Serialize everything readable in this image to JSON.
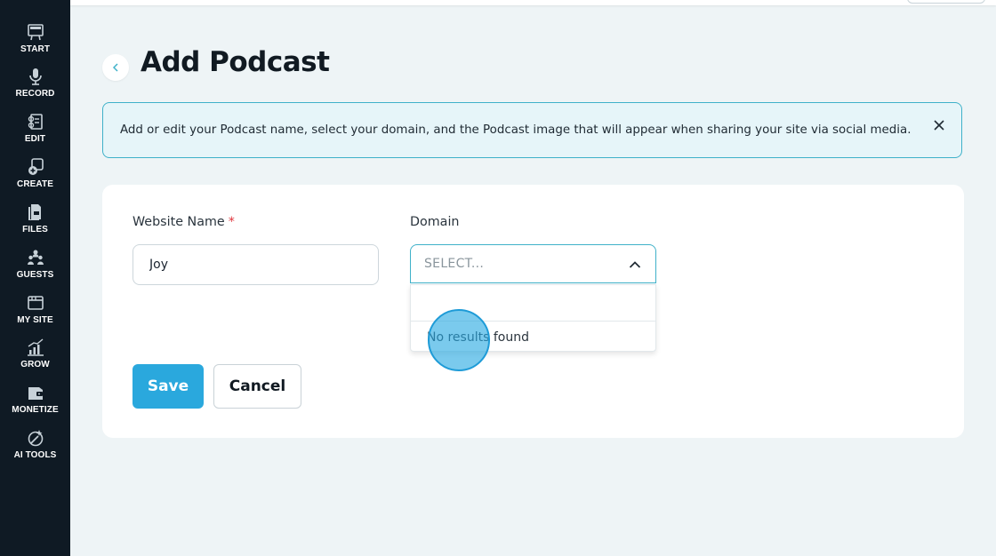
{
  "sidebar": {
    "items": [
      {
        "label": "START",
        "icon": "start-icon"
      },
      {
        "label": "RECORD",
        "icon": "microphone-icon"
      },
      {
        "label": "EDIT",
        "icon": "edit-icon"
      },
      {
        "label": "CREATE",
        "icon": "create-icon"
      },
      {
        "label": "FILES",
        "icon": "files-icon"
      },
      {
        "label": "GUESTS",
        "icon": "guests-icon"
      },
      {
        "label": "MY SITE",
        "icon": "my-site-icon"
      },
      {
        "label": "GROW",
        "icon": "grow-chart-icon"
      },
      {
        "label": "MONETIZE",
        "icon": "monetize-icon"
      },
      {
        "label": "AI TOOLS",
        "icon": "ai-tools-icon"
      }
    ]
  },
  "header": {
    "title": "Add Podcast",
    "back_icon": "chevron-left-icon"
  },
  "banner": {
    "text": "Add or edit your Podcast name, select your domain, and the Podcast image that will appear when sharing your site via social media.",
    "close_icon": "close-icon"
  },
  "form": {
    "website_name": {
      "label": "Website Name",
      "required_mark": "*",
      "value": "Joy"
    },
    "domain": {
      "label": "Domain",
      "placeholder": "SELECT...",
      "search_value": "",
      "no_results_text": "No results found",
      "chevron_icon": "chevron-up-icon"
    },
    "save_label": "Save",
    "cancel_label": "Cancel"
  },
  "colors": {
    "sidebar_bg": "#0f1a24",
    "accent": "#2aa8dd",
    "banner_border": "#3fb1c9",
    "banner_bg": "#e6f5f9",
    "required": "#e0353c"
  }
}
